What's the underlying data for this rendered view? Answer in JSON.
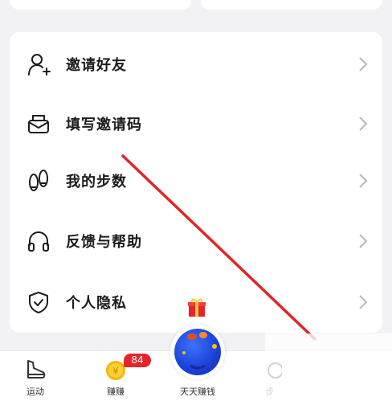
{
  "menu": {
    "items": [
      {
        "label": "邀请好友",
        "icon": "add-user-icon"
      },
      {
        "label": "填写邀请码",
        "icon": "envelope-icon"
      },
      {
        "label": "我的步数",
        "icon": "footprints-icon"
      },
      {
        "label": "反馈与帮助",
        "icon": "headset-icon"
      },
      {
        "label": "个人隐私",
        "icon": "shield-check-icon"
      }
    ]
  },
  "tabbar": {
    "tabs": [
      {
        "label": "运动",
        "icon": "sneaker-icon"
      },
      {
        "label": "赚赚",
        "icon": "coin-icon",
        "badge": "84"
      },
      {
        "label": "天天赚钱",
        "icon": "globe-orb-icon"
      },
      {
        "label": "步",
        "icon": "partial-tab-icon"
      }
    ]
  },
  "colors": {
    "annotation_arrow": "#e0262a",
    "badge": "#e8232a",
    "orb": "#1b3fd6",
    "text": "#1c1c1c"
  }
}
